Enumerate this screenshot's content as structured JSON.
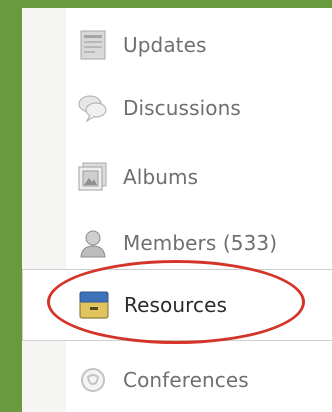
{
  "nav": {
    "items": [
      {
        "label": "Updates",
        "icon": "updates-icon"
      },
      {
        "label": "Discussions",
        "icon": "discussions-icon"
      },
      {
        "label": "Albums",
        "icon": "albums-icon"
      },
      {
        "label": "Members (533)",
        "icon": "members-icon"
      },
      {
        "label": "Resources",
        "icon": "resources-icon",
        "selected": true
      },
      {
        "label": "Conferences",
        "icon": "conferences-icon"
      }
    ]
  },
  "colors": {
    "background": "#6a9a3e",
    "highlight": "#d5342a",
    "text": "#6f6f6f",
    "selected_text": "#2b2b2b"
  }
}
